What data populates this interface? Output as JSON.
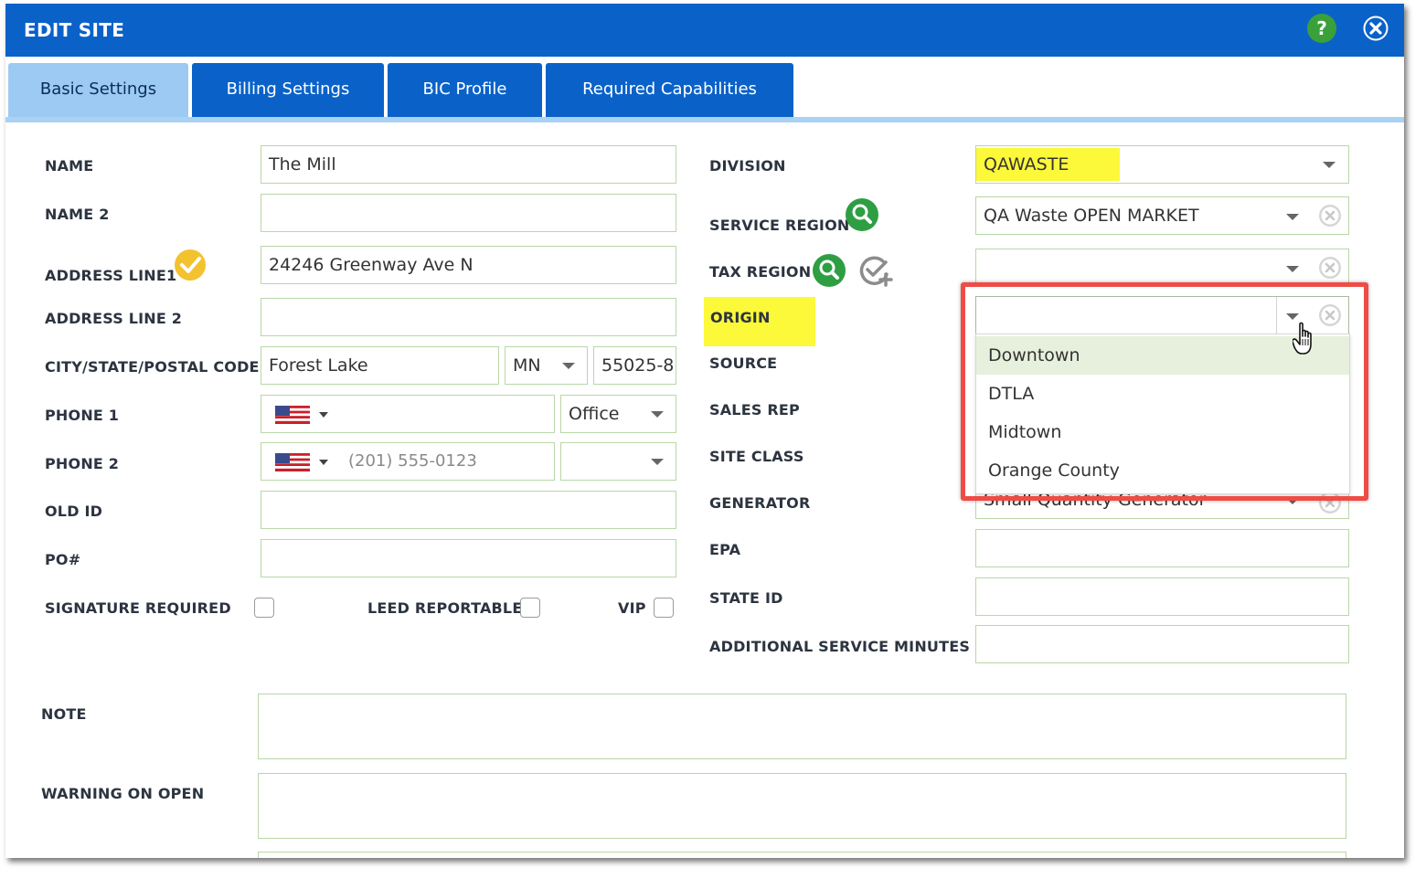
{
  "window": {
    "title": "EDIT SITE"
  },
  "tabs": [
    {
      "label": "Basic Settings",
      "active": true
    },
    {
      "label": "Billing Settings"
    },
    {
      "label": "BIC Profile"
    },
    {
      "label": "Required Capabilities"
    }
  ],
  "left": {
    "name": {
      "label": "NAME",
      "value": "The Mill"
    },
    "name2": {
      "label": "NAME 2",
      "value": ""
    },
    "address1": {
      "label": "ADDRESS LINE1",
      "value": "24246 Greenway Ave N"
    },
    "address2": {
      "label": "ADDRESS LINE 2",
      "value": ""
    },
    "city_state_zip": {
      "label": "CITY/STATE/POSTAL CODE",
      "city": "Forest Lake",
      "state": "MN",
      "zip": "55025-8"
    },
    "phone1": {
      "label": "PHONE 1",
      "number": "",
      "type": "Office"
    },
    "phone2": {
      "label": "PHONE 2",
      "placeholder": "(201) 555-0123",
      "type": ""
    },
    "old_id": {
      "label": "OLD ID",
      "value": ""
    },
    "po": {
      "label": "PO#",
      "value": ""
    },
    "signature_required": {
      "label": "SIGNATURE REQUIRED",
      "checked": false
    },
    "leed_reportable": {
      "label": "LEED REPORTABLE",
      "checked": false
    },
    "vip": {
      "label": "VIP",
      "checked": false
    }
  },
  "right": {
    "division": {
      "label": "DIVISION",
      "value": "QAWASTE"
    },
    "service_region": {
      "label": "SERVICE REGION",
      "value": "QA Waste OPEN MARKET"
    },
    "tax_region": {
      "label": "TAX REGION",
      "value": ""
    },
    "origin": {
      "label": "ORIGIN",
      "value": ""
    },
    "source": {
      "label": "SOURCE"
    },
    "sales_rep": {
      "label": "SALES REP"
    },
    "site_class": {
      "label": "SITE CLASS"
    },
    "generator": {
      "label": "GENERATOR",
      "value": "Small Quantity Generator"
    },
    "epa": {
      "label": "EPA",
      "value": ""
    },
    "state_id": {
      "label": "STATE ID",
      "value": ""
    },
    "additional_service_minutes": {
      "label": "ADDITIONAL SERVICE MINUTES",
      "value": ""
    }
  },
  "origin_dropdown": {
    "options": [
      "Downtown",
      "DTLA",
      "Midtown",
      "Orange County"
    ],
    "hovered_index": 0
  },
  "note": {
    "label": "NOTE",
    "value": ""
  },
  "warning_on_open": {
    "label": "WARNING ON OPEN",
    "value": ""
  },
  "icons": {
    "help": "help-icon",
    "close": "close-icon",
    "validated": "checkmark-icon",
    "search": "search-icon",
    "add_check": "add-check-icon",
    "flag": "us-flag-icon",
    "cursor": "hand-pointer-icon"
  },
  "colors": {
    "titlebar": "#0a62c9",
    "active_tab": "#9ccaf3",
    "highlight": "#fcf83a",
    "search_green": "#2e9e43",
    "check_yellow": "#f3c22f",
    "callout_red": "#ee4c45"
  },
  "help_glyph": "?"
}
